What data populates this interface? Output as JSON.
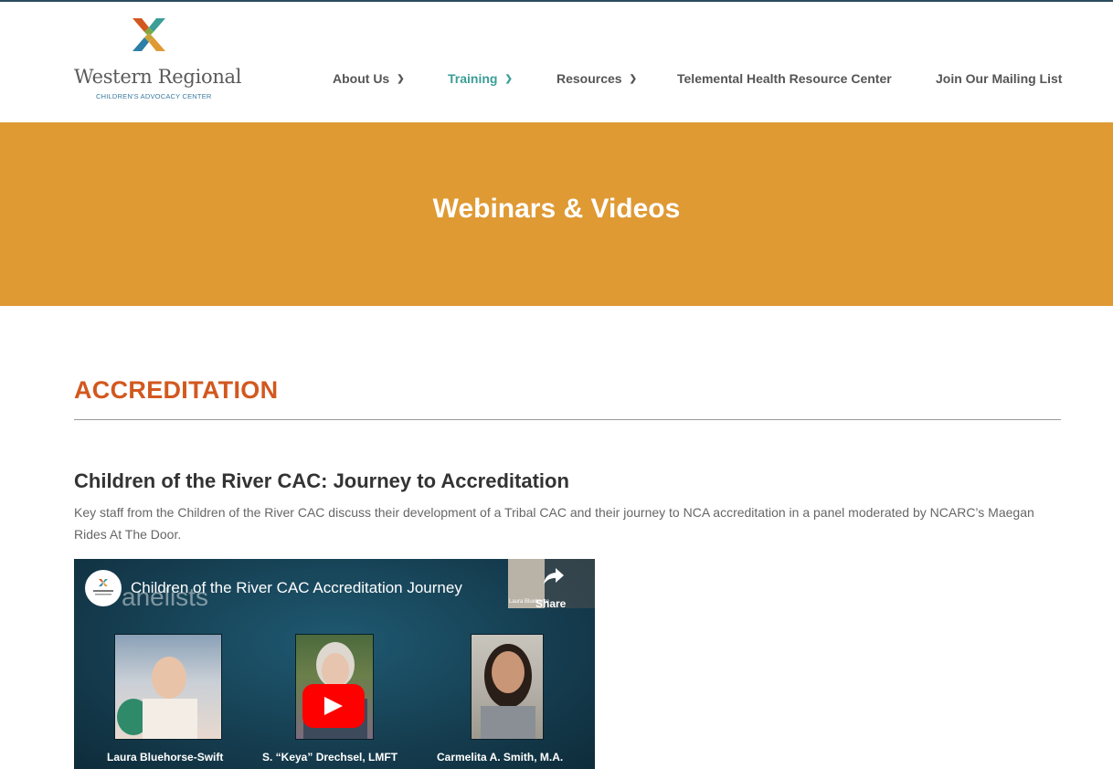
{
  "site": {
    "logo_name": "Western Regional",
    "logo_sub": "CHILDREN'S ADVOCACY CENTER"
  },
  "nav": {
    "items": [
      {
        "label": "About Us",
        "has_dropdown": true,
        "active": false
      },
      {
        "label": "Training",
        "has_dropdown": true,
        "active": true
      },
      {
        "label": "Resources",
        "has_dropdown": true,
        "active": false
      },
      {
        "label": "Telemental Health Resource Center",
        "has_dropdown": false,
        "active": false
      },
      {
        "label": "Join Our Mailing List",
        "has_dropdown": false,
        "active": false
      }
    ]
  },
  "banner": {
    "title": "Webinars & Videos",
    "color": "#df9a34"
  },
  "section": {
    "heading": "ACCREDITATION",
    "heading_color": "#d2581f"
  },
  "video": {
    "title": "Children of the River CAC: Journey to Accreditation",
    "description": "Key staff from the Children of the River CAC discuss their development of a Tribal CAC and their journey to NCA accreditation in a panel moderated by NCARC’s Maegan Rides At The Door.",
    "player_title": "Children of the River CAC Accreditation Journey",
    "background_text": "anelists",
    "share_label": "Share",
    "share_thumb_caption": "Laura Bluehorse",
    "panelists": [
      {
        "name": "Laura Bluehorse-Swift"
      },
      {
        "name": "S. “Keya” Drechsel, LMFT"
      },
      {
        "name": "Carmelita A. Smith, M.A."
      }
    ]
  },
  "colors": {
    "accent_teal": "#3b9e97",
    "youtube_red": "#ff0000"
  }
}
